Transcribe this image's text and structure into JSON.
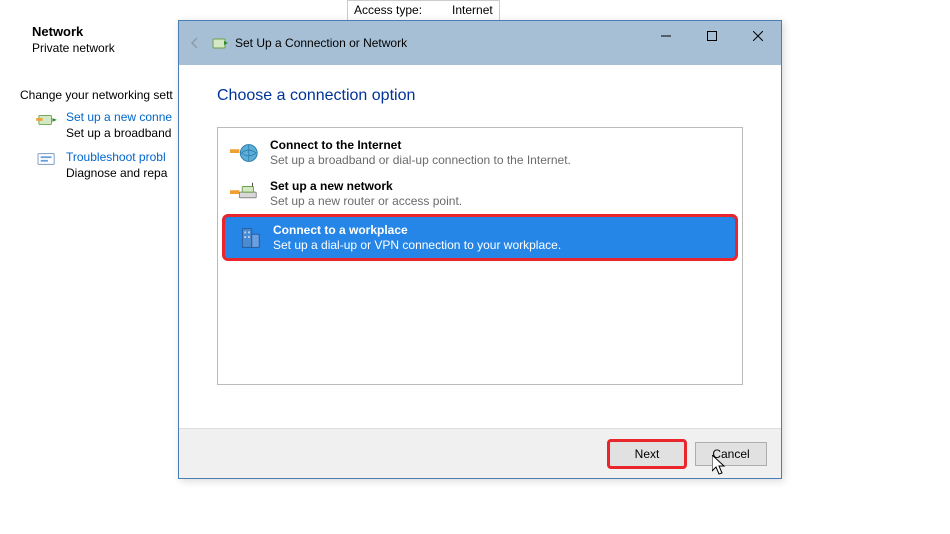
{
  "bg": {
    "access_label": "Access type:",
    "access_value": "Internet",
    "network_title": "Network",
    "network_sub": "Private network",
    "change_title": "Change your networking sett",
    "setup_link": "Set up a new conne",
    "setup_desc": "Set up a broadband",
    "troubleshoot_link": "Troubleshoot probl",
    "troubleshoot_desc": "Diagnose and repa"
  },
  "dialog": {
    "title": "Set Up a Connection or Network",
    "heading": "Choose a connection option",
    "options": [
      {
        "title": "Connect to the Internet",
        "desc": "Set up a broadband or dial-up connection to the Internet."
      },
      {
        "title": "Set up a new network",
        "desc": "Set up a new router or access point."
      },
      {
        "title": "Connect to a workplace",
        "desc": "Set up a dial-up or VPN connection to your workplace."
      }
    ],
    "next_label": "Next",
    "cancel_label": "Cancel"
  }
}
